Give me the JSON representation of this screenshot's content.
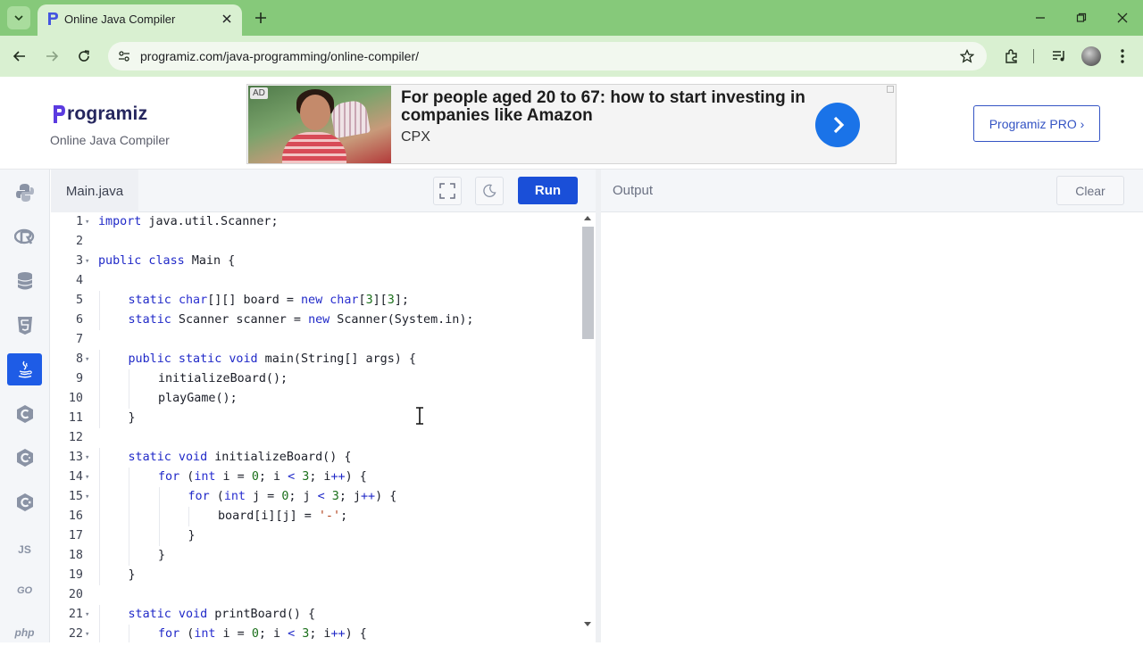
{
  "browser": {
    "tab_title": "Online Java Compiler",
    "url": "programiz.com/java-programming/online-compiler/"
  },
  "header": {
    "logo_text": "rogramiz",
    "subtitle": "Online Java Compiler",
    "pro_button": "Programiz PRO ›"
  },
  "ad": {
    "badge": "AD",
    "headline": "For people aged 20 to 67: how to start investing in companies like Amazon",
    "brand": "CPX"
  },
  "rail": {
    "js_label": "JS",
    "go_label": "GO",
    "php_label": "php"
  },
  "editor": {
    "file_tab": "Main.java",
    "run_label": "Run"
  },
  "output": {
    "label": "Output",
    "clear_label": "Clear"
  },
  "code_lines": [
    {
      "n": "1",
      "fold": true,
      "indent": 0,
      "tokens": [
        [
          "k",
          "import"
        ],
        [
          "p",
          " java.util.Scanner;"
        ]
      ]
    },
    {
      "n": "2",
      "fold": false,
      "indent": 0,
      "tokens": []
    },
    {
      "n": "3",
      "fold": true,
      "indent": 0,
      "tokens": [
        [
          "k",
          "public class"
        ],
        [
          "p",
          " Main {"
        ]
      ]
    },
    {
      "n": "4",
      "fold": false,
      "indent": 0,
      "tokens": []
    },
    {
      "n": "5",
      "fold": false,
      "indent": 1,
      "tokens": [
        [
          "k",
          "static"
        ],
        [
          "p",
          " "
        ],
        [
          "t",
          "char"
        ],
        [
          "p",
          "[][] board = "
        ],
        [
          "k",
          "new"
        ],
        [
          "p",
          " "
        ],
        [
          "t",
          "char"
        ],
        [
          "p",
          "["
        ],
        [
          "n",
          "3"
        ],
        [
          "p",
          "]["
        ],
        [
          "n",
          "3"
        ],
        [
          "p",
          "];"
        ]
      ]
    },
    {
      "n": "6",
      "fold": false,
      "indent": 1,
      "tokens": [
        [
          "k",
          "static"
        ],
        [
          "p",
          " Scanner scanner = "
        ],
        [
          "k",
          "new"
        ],
        [
          "p",
          " Scanner(System.in);"
        ]
      ]
    },
    {
      "n": "7",
      "fold": false,
      "indent": 0,
      "tokens": []
    },
    {
      "n": "8",
      "fold": true,
      "indent": 1,
      "tokens": [
        [
          "k",
          "public static void"
        ],
        [
          "p",
          " main(String[] args) {"
        ]
      ]
    },
    {
      "n": "9",
      "fold": false,
      "indent": 2,
      "tokens": [
        [
          "p",
          "initializeBoard();"
        ]
      ]
    },
    {
      "n": "10",
      "fold": false,
      "indent": 2,
      "tokens": [
        [
          "p",
          "playGame();"
        ]
      ]
    },
    {
      "n": "11",
      "fold": false,
      "indent": 1,
      "tokens": [
        [
          "p",
          "}"
        ]
      ]
    },
    {
      "n": "12",
      "fold": false,
      "indent": 0,
      "tokens": []
    },
    {
      "n": "13",
      "fold": true,
      "indent": 1,
      "tokens": [
        [
          "k",
          "static void"
        ],
        [
          "p",
          " initializeBoard() {"
        ]
      ]
    },
    {
      "n": "14",
      "fold": true,
      "indent": 2,
      "tokens": [
        [
          "k",
          "for"
        ],
        [
          "p",
          " ("
        ],
        [
          "t",
          "int"
        ],
        [
          "p",
          " i = "
        ],
        [
          "n",
          "0"
        ],
        [
          "p",
          "; i "
        ],
        [
          "k",
          "<"
        ],
        [
          "p",
          " "
        ],
        [
          "n",
          "3"
        ],
        [
          "p",
          "; i"
        ],
        [
          "k",
          "++"
        ],
        [
          "p",
          ") {"
        ]
      ]
    },
    {
      "n": "15",
      "fold": true,
      "indent": 3,
      "tokens": [
        [
          "k",
          "for"
        ],
        [
          "p",
          " ("
        ],
        [
          "t",
          "int"
        ],
        [
          "p",
          " j = "
        ],
        [
          "n",
          "0"
        ],
        [
          "p",
          "; j "
        ],
        [
          "k",
          "<"
        ],
        [
          "p",
          " "
        ],
        [
          "n",
          "3"
        ],
        [
          "p",
          "; j"
        ],
        [
          "k",
          "++"
        ],
        [
          "p",
          ") {"
        ]
      ]
    },
    {
      "n": "16",
      "fold": false,
      "indent": 4,
      "tokens": [
        [
          "p",
          "board[i][j] = "
        ],
        [
          "s",
          "'-'"
        ],
        [
          "p",
          ";"
        ]
      ]
    },
    {
      "n": "17",
      "fold": false,
      "indent": 3,
      "tokens": [
        [
          "p",
          "}"
        ]
      ]
    },
    {
      "n": "18",
      "fold": false,
      "indent": 2,
      "tokens": [
        [
          "p",
          "}"
        ]
      ]
    },
    {
      "n": "19",
      "fold": false,
      "indent": 1,
      "tokens": [
        [
          "p",
          "}"
        ]
      ]
    },
    {
      "n": "20",
      "fold": false,
      "indent": 0,
      "tokens": []
    },
    {
      "n": "21",
      "fold": true,
      "indent": 1,
      "tokens": [
        [
          "k",
          "static void"
        ],
        [
          "p",
          " printBoard() {"
        ]
      ]
    },
    {
      "n": "22",
      "fold": true,
      "indent": 2,
      "tokens": [
        [
          "k",
          "for"
        ],
        [
          "p",
          " ("
        ],
        [
          "t",
          "int"
        ],
        [
          "p",
          " i = "
        ],
        [
          "n",
          "0"
        ],
        [
          "p",
          "; i "
        ],
        [
          "k",
          "<"
        ],
        [
          "p",
          " "
        ],
        [
          "n",
          "3"
        ],
        [
          "p",
          "; i"
        ],
        [
          "k",
          "++"
        ],
        [
          "p",
          ") {"
        ]
      ]
    }
  ]
}
